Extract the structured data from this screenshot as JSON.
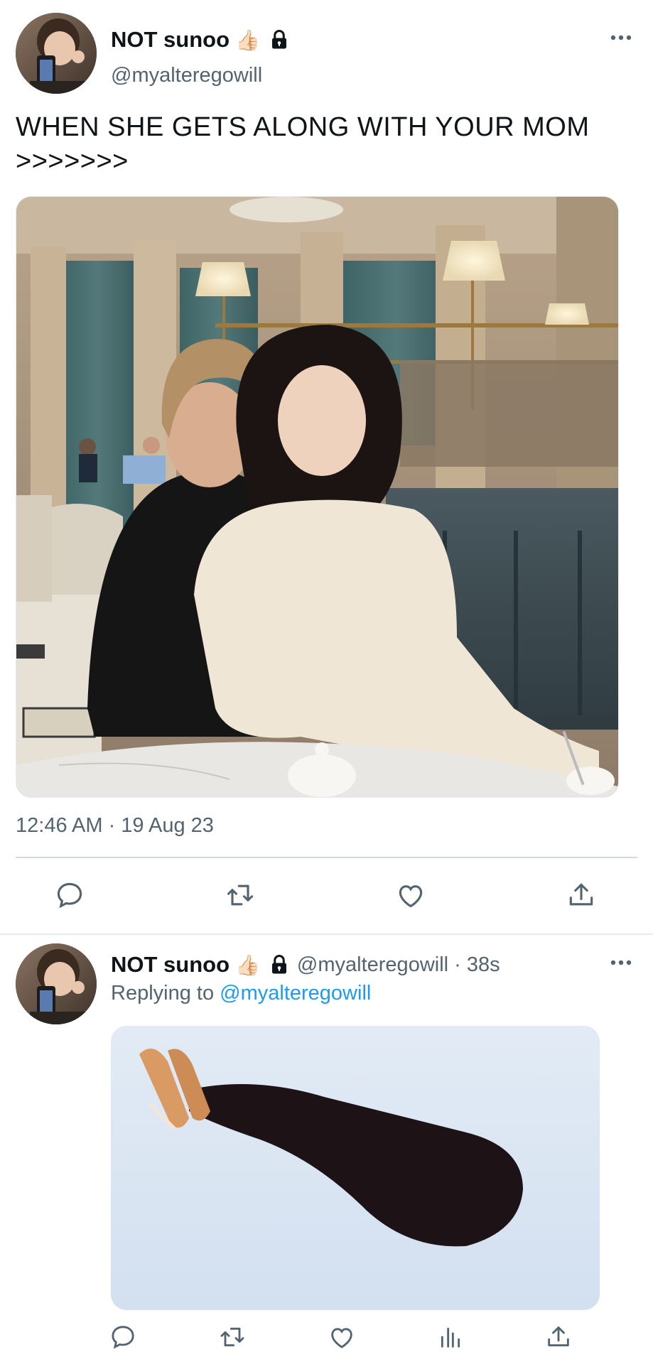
{
  "main_tweet": {
    "display_name": "NOT sunoo",
    "name_emoji": "👍🏻",
    "handle": "@myalteregowill",
    "text_line1": "WHEN SHE GETS ALONG WITH YOUR MOM",
    "text_line2": ">>>>>>>",
    "timestamp": "12:46 AM · 19 Aug 23"
  },
  "reply_tweet": {
    "display_name": "NOT sunoo",
    "name_emoji": "👍🏻",
    "handle_time": "@myalteregowill · 38s",
    "replying_prefix": "Replying to ",
    "replying_handle": "@myalteregowill"
  },
  "icons": {
    "lock": "lock-icon",
    "more": "more-icon",
    "reply": "reply-icon",
    "retweet": "retweet-icon",
    "like": "like-icon",
    "views": "views-icon",
    "share": "share-icon"
  },
  "colors": {
    "text": "#0f1419",
    "secondary": "#536471",
    "link": "#1d9bf0",
    "divider": "#cfd9de"
  }
}
